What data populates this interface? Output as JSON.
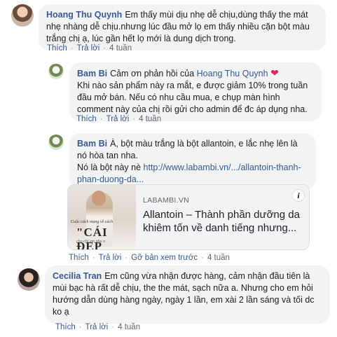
{
  "comments": [
    {
      "author": "Hoang Thu Quynh",
      "text": "Em thấy mùi dịu nhẹ dễ chịu,dùng thấy the mát nhẹ nhàng dễ chịu.nhưng lúc đầu mở lọ em thấy nhiều cặn bột màu trắng chị ạ, lúc gần hết lọ mới là dung dịch trong.",
      "actions": {
        "like": "Thích",
        "reply": "Trả lời",
        "time": "4 tuần"
      }
    },
    {
      "author": "Bam Bi",
      "text_prefix": "Cảm ơn phản hồi của",
      "mention": "Hoang Thu Quynh",
      "heart": "❤",
      "text": "Khi nào sản phẩm này ra mắt, e được giảm 10% trong tuần đầu mở bán. Nếu có nhu cầu mua, e chụp màn hình comment này của chị rồi gửi cho admin để đc áp dụng nha.",
      "actions": {
        "like": "Thích",
        "reply": "Trả lời",
        "time": "4 tuần"
      }
    },
    {
      "author": "Bam Bi",
      "text": "À, bột màu trắng là bột allantoin, e lắc nhẹ lên là nó hòa tan nha.",
      "text2": "Nó là bột này nè",
      "link": "http://www.labambi.vn/.../allantoin-thanh-phan-duong-da...",
      "preview": {
        "domain": "LABAMBI.VN",
        "title": "Allantoin – Thành phần dưỡng da khiêm tốn về danh tiếng nhưng...",
        "image_caption_small": "Cuộc cách mạng về cách",
        "image_caption_big": "\"CÁI ĐẸP",
        "image_caption_bottom": "cho chỉ em phụ n"
      },
      "actions": {
        "like": "Thích",
        "reply": "Trả lời",
        "remove_preview": "Gỡ bản xem trước",
        "time": "4 tuần"
      }
    },
    {
      "author": "Cecilia Tran",
      "text": "Em cũng vừa nhận được hàng, cảm nhận đầu tiên là mùi bạc hà rất dễ chịu, the the mát, sạch nữa a. Nhưng cho em hỏi hướng dẫn dùng hàng ngày, ngày 1 lần, em xài 2 lần sáng và tối dc ko ạ",
      "actions": {
        "like": "Thích",
        "reply": "Trả lời",
        "time": "4 tuần"
      }
    }
  ],
  "colors": {
    "link": "#385898",
    "bubble": "#f2f3f5",
    "heart": "#e0245e"
  },
  "icons": {
    "info": "info-icon",
    "heart": "heart-icon"
  }
}
